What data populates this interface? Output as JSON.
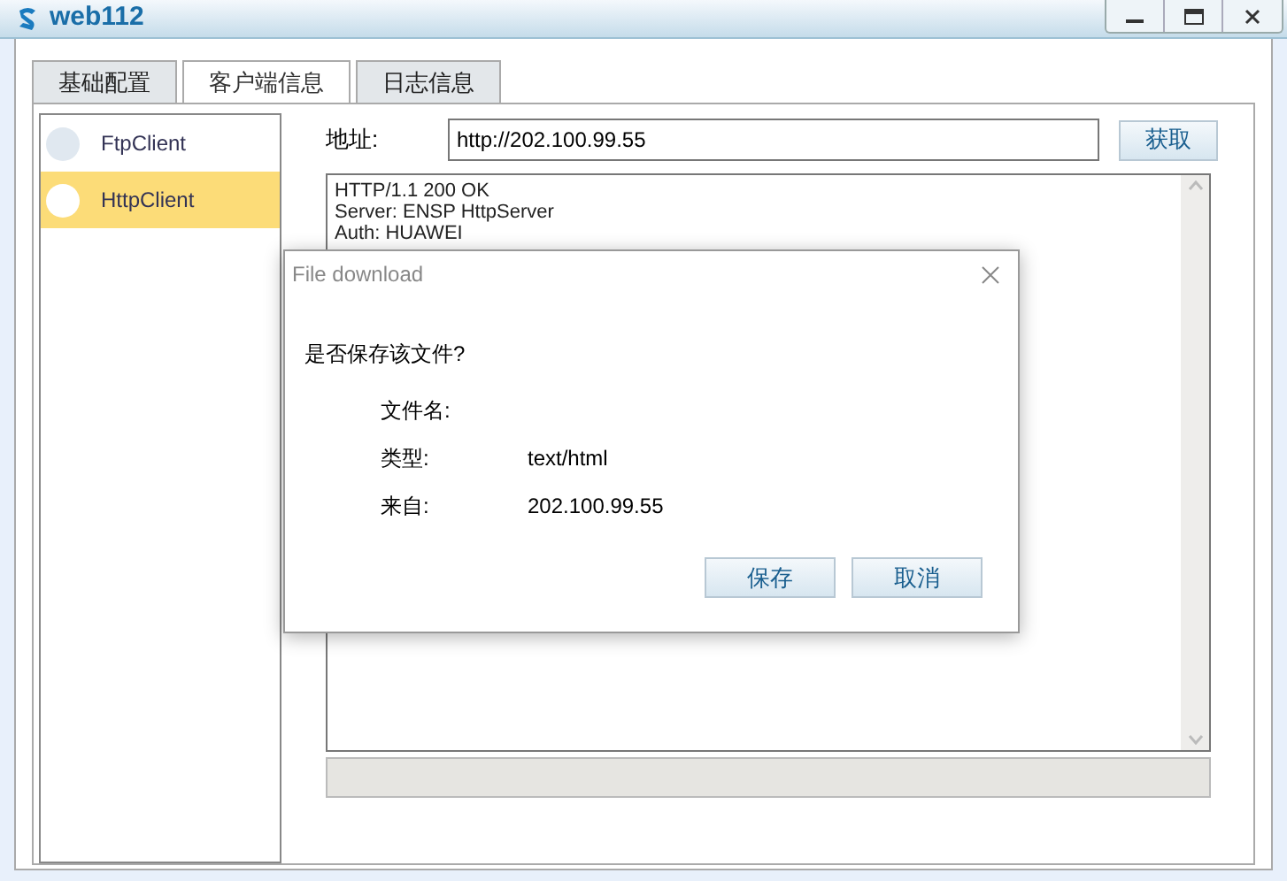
{
  "window": {
    "title": "web112"
  },
  "tabs": [
    {
      "label": "基础配置",
      "selected": false
    },
    {
      "label": "客户端信息",
      "selected": true
    },
    {
      "label": "日志信息",
      "selected": false
    }
  ],
  "clients": [
    {
      "name": "FtpClient",
      "selected": false
    },
    {
      "name": "HttpClient",
      "selected": true
    }
  ],
  "address": {
    "label": "地址:",
    "value": "http://202.100.99.55",
    "button": "获取"
  },
  "response_lines": [
    "HTTP/1.1 200 OK",
    "Server: ENSP HttpServer",
    "Auth: HUAWEI"
  ],
  "dialog": {
    "title": "File download",
    "question": "是否保存该文件?",
    "fields": [
      {
        "label": "文件名:"
      },
      {
        "label": "类型:",
        "value": "text/html"
      },
      {
        "label": "来自:",
        "value": "202.100.99.55"
      }
    ],
    "buttons": [
      "保存",
      "取消"
    ]
  }
}
